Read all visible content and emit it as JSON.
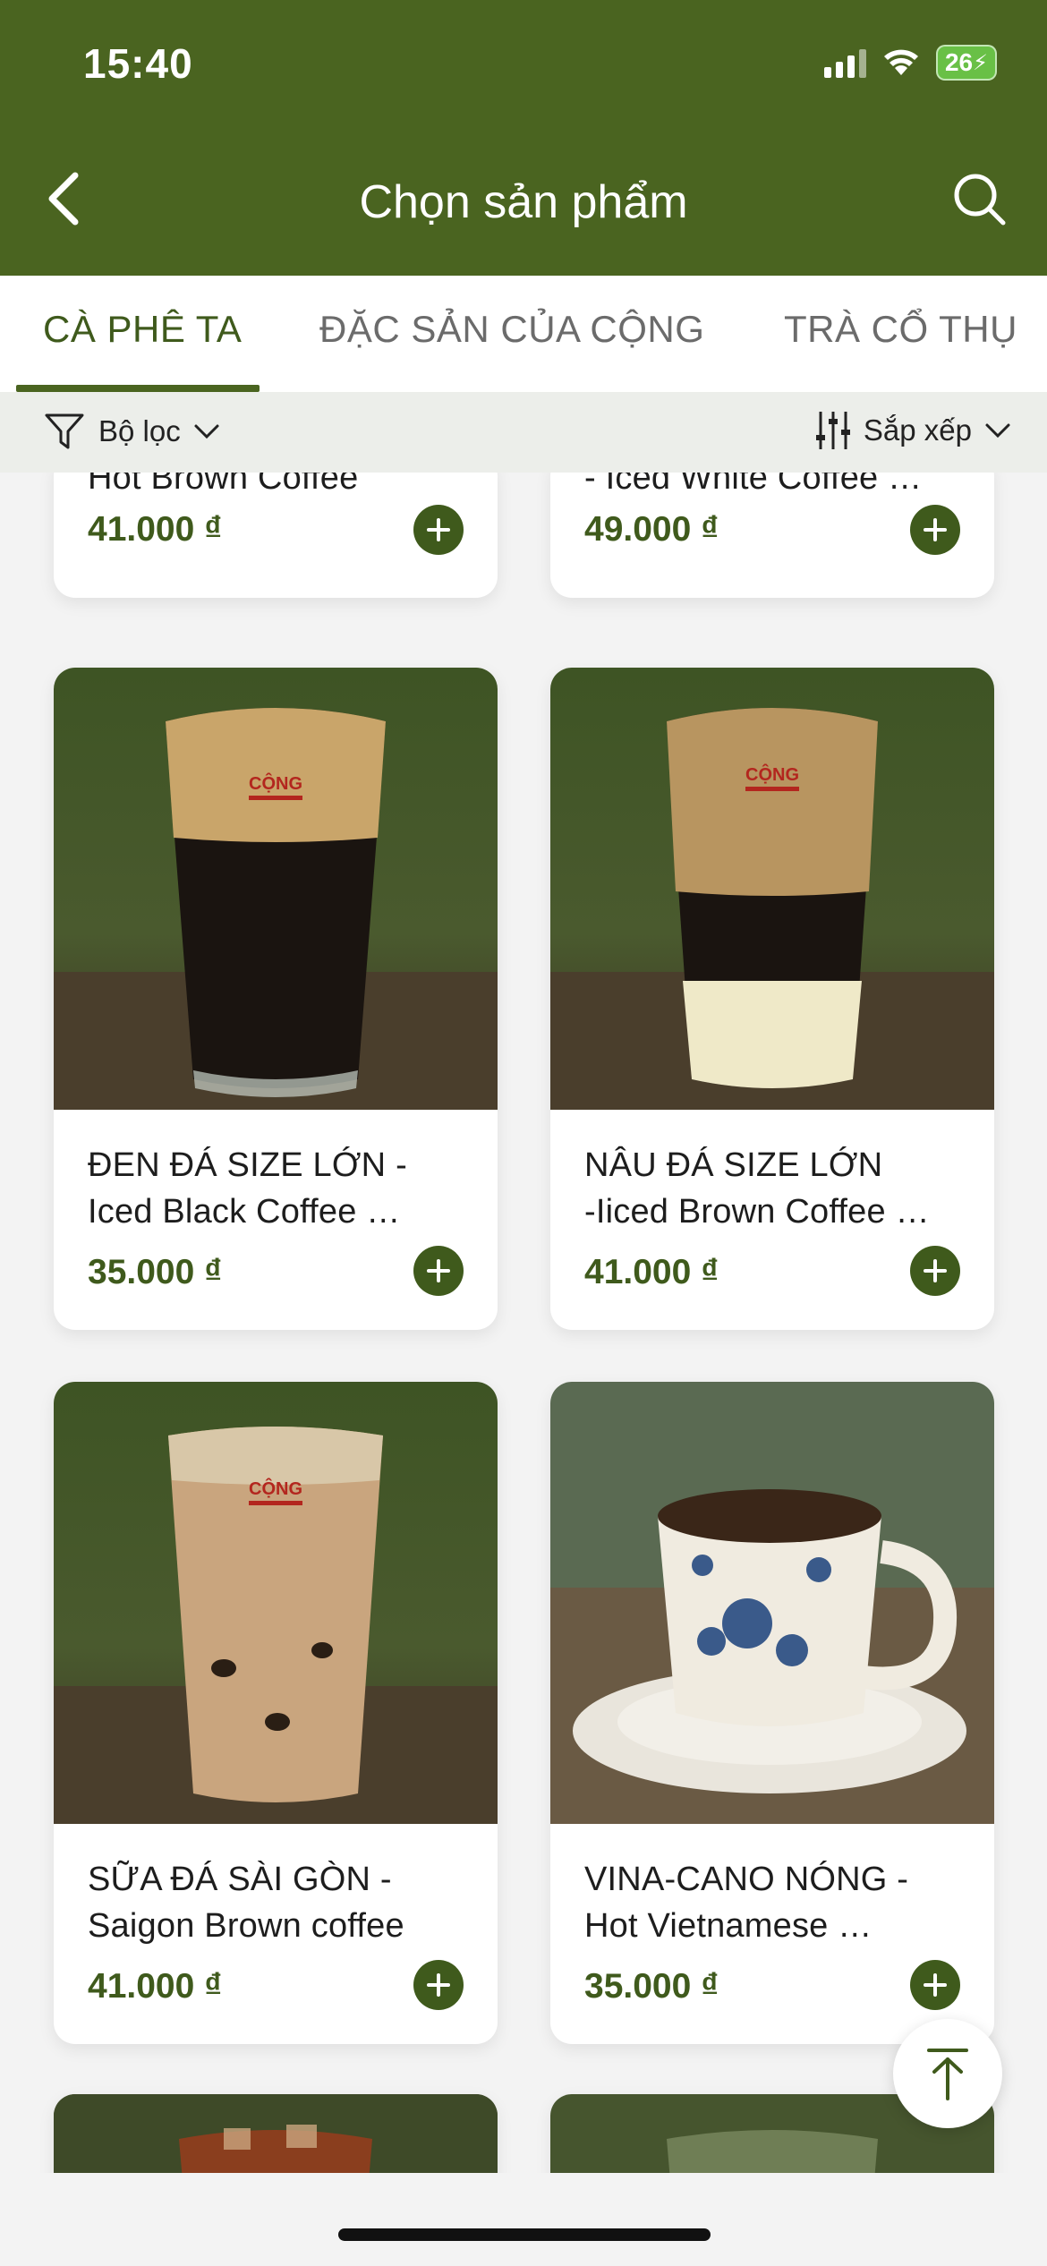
{
  "status_bar": {
    "time": "15:40",
    "battery": "26"
  },
  "header": {
    "title": "Chọn sản phẩm"
  },
  "tabs": [
    {
      "label": "CÀ PHÊ TA",
      "active": true
    },
    {
      "label": "ĐẶC SẢN CỦA CỘNG",
      "active": false
    },
    {
      "label": "TRÀ CỔ THỤ",
      "active": false
    }
  ],
  "filterbar": {
    "filter_label": "Bộ lọc",
    "sort_label": "Sắp xếp"
  },
  "products": [
    {
      "name_line1": "Hot  Brown Coffee",
      "name_line2": "",
      "price": "41.000 ₫",
      "partial": true
    },
    {
      "name_line1": "- Iced White Coffee …",
      "name_line2": "",
      "price": "49.000 ₫",
      "partial": true
    },
    {
      "name_line1": "ĐEN ĐÁ SIZE LỚN -",
      "name_line2": "Iced Black Coffee …",
      "price": "35.000 ₫",
      "image": "iced black coffee"
    },
    {
      "name_line1": "NÂU ĐÁ SIZE LỚN",
      "name_line2": "-Iiced Brown Coffee …",
      "price": "41.000 ₫",
      "image": "iced brown coffee"
    },
    {
      "name_line1": "SỮA ĐÁ SÀI GÒN -",
      "name_line2": "Saigon Brown coffee",
      "price": "41.000 ₫",
      "image": "saigon milk coffee"
    },
    {
      "name_line1": "VINA-CANO NÓNG -",
      "name_line2": "Hot Vietnamese …",
      "price": "35.000 ₫",
      "image": "hot coffee cup"
    }
  ],
  "logo_text": "CỘNG",
  "colors": {
    "brand": "#4a6420",
    "price": "#3f5a1c",
    "background": "#f3f3f3"
  }
}
